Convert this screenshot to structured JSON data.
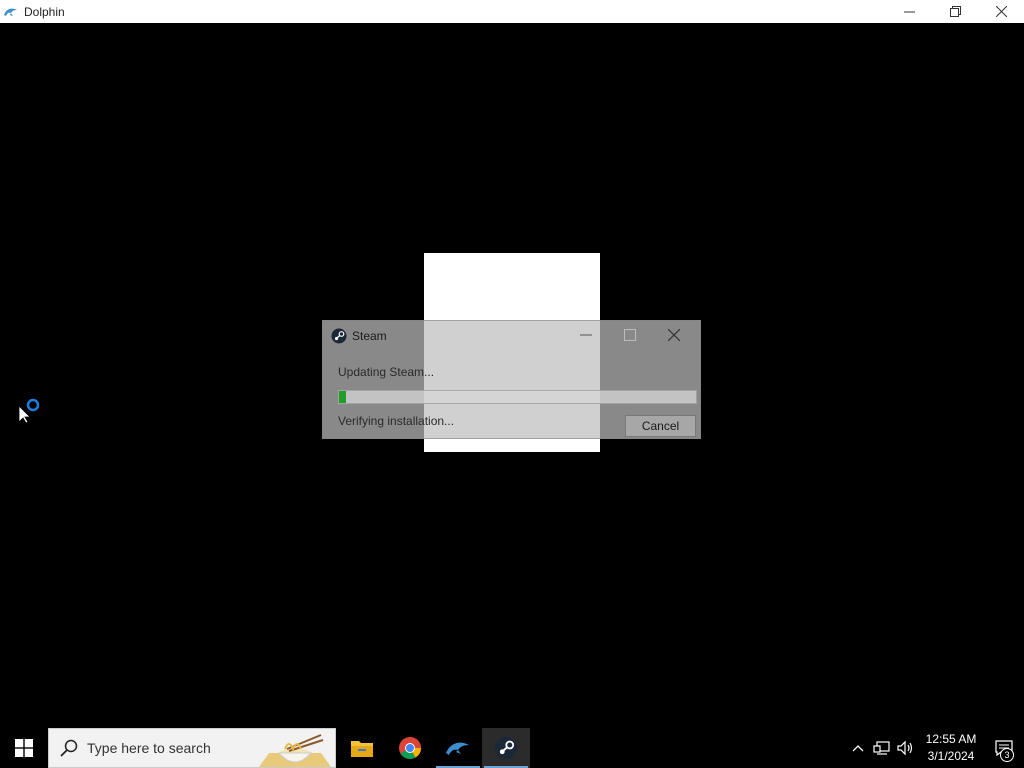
{
  "window": {
    "title": "Dolphin",
    "icon": "dolphin-icon"
  },
  "dialog": {
    "title": "Steam",
    "icon": "steam-icon",
    "message": "Updating Steam...",
    "progress": 0.02,
    "status": "Verifying installation...",
    "cancel_label": "Cancel"
  },
  "taskbar": {
    "search_placeholder": "Type here to search",
    "apps": [
      {
        "name": "file-explorer",
        "icon": "folder-icon"
      },
      {
        "name": "chrome",
        "icon": "chrome-icon"
      },
      {
        "name": "dolphin",
        "icon": "dolphin-icon"
      },
      {
        "name": "steam",
        "icon": "steam-icon"
      }
    ],
    "clock": {
      "time": "12:55 AM",
      "date": "3/1/2024"
    },
    "notification_count": "3"
  },
  "colors": {
    "progress_fill": "#1f9e2a",
    "taskbar_accent": "#6aa4d8"
  }
}
